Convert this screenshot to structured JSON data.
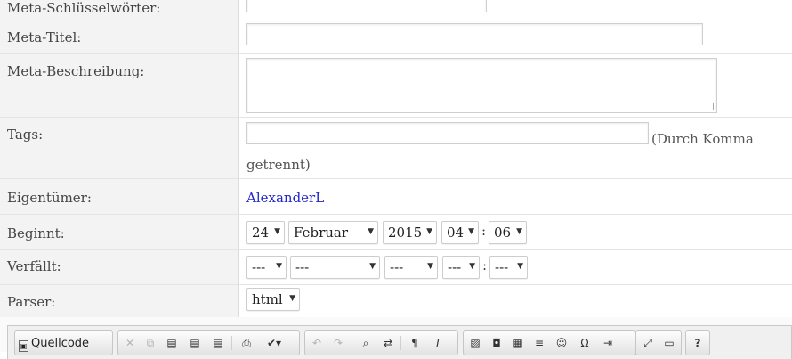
{
  "fields": {
    "meta_keywords": {
      "label": "Meta-Schlüsselwörter:",
      "value": ""
    },
    "meta_title": {
      "label": "Meta-Titel:",
      "value": ""
    },
    "meta_description": {
      "label": "Meta-Beschreibung:",
      "value": ""
    },
    "tags": {
      "label": "Tags:",
      "value": "",
      "hint": "(Durch Komma getrennt)"
    },
    "owner": {
      "label": "Eigentümer:",
      "value": "AlexanderL"
    },
    "begins": {
      "label": "Beginnt:",
      "day": "24",
      "month": "Februar",
      "year": "2015",
      "hour": "04",
      "minute": "06"
    },
    "expires": {
      "label": "Verfällt:",
      "day": "---",
      "month": "---",
      "year": "---",
      "hour": "---",
      "minute": "---"
    },
    "parser": {
      "label": "Parser:",
      "value": "html"
    }
  },
  "time_separator": ":",
  "toolbar": {
    "source_label": "Quellcode",
    "icons": [
      "cut-icon",
      "copy-icon",
      "paste-icon",
      "paste-text-icon",
      "paste-word-icon",
      "print-icon",
      "spellcheck-icon",
      "undo-icon",
      "redo-icon",
      "find-icon",
      "replace-icon",
      "format-icon",
      "remove-format-icon",
      "image-icon",
      "flash-icon",
      "table-icon",
      "horizontal-rule-icon",
      "smiley-icon",
      "special-char-icon",
      "page-break-icon",
      "maximize-icon",
      "show-blocks-icon",
      "help-icon"
    ]
  },
  "colors": {
    "label_bg": "#f3f3f3",
    "link": "#2228c8",
    "border": "#e4e4e4"
  }
}
